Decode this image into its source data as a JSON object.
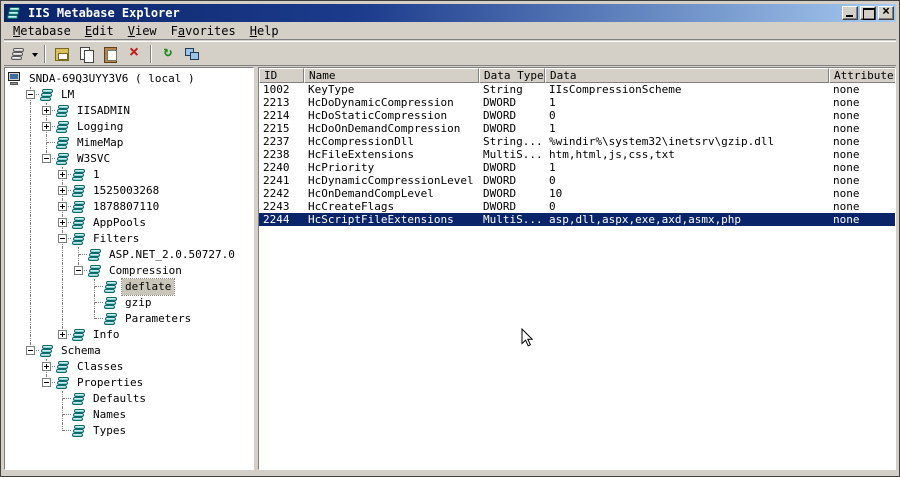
{
  "window": {
    "title": "IIS Metabase Explorer",
    "controls": [
      {
        "name": "minimize"
      },
      {
        "name": "maximize"
      },
      {
        "name": "close"
      }
    ]
  },
  "menu": {
    "items": [
      {
        "label": "Metabase",
        "accel": 0
      },
      {
        "label": "Edit",
        "accel": 0
      },
      {
        "label": "View",
        "accel": 0
      },
      {
        "label": "Favorites",
        "accel": 1
      },
      {
        "label": "Help",
        "accel": 0
      }
    ]
  },
  "toolbar": {
    "buttons": [
      {
        "name": "new-key",
        "icon": "stack-gray",
        "dropdown": true
      },
      {
        "separator": true
      },
      {
        "name": "save",
        "icon": "save"
      },
      {
        "name": "copy",
        "icon": "copy"
      },
      {
        "name": "paste",
        "icon": "paste"
      },
      {
        "name": "delete",
        "icon": "delete"
      },
      {
        "separator": true
      },
      {
        "name": "refresh",
        "icon": "refresh"
      },
      {
        "name": "connect",
        "icon": "network"
      }
    ]
  },
  "tree": {
    "items": [
      {
        "label": "SNDA-69Q3UYY3V6 ( local )",
        "level": 0,
        "expand": "",
        "icon": "computer"
      },
      {
        "label": "LM",
        "level": 1,
        "expand": "-",
        "icon": "stack"
      },
      {
        "label": "IISADMIN",
        "level": 2,
        "expand": "+",
        "icon": "stack"
      },
      {
        "label": "Logging",
        "level": 2,
        "expand": "+",
        "icon": "stack"
      },
      {
        "label": "MimeMap",
        "level": 2,
        "expand": "",
        "icon": "stack"
      },
      {
        "label": "W3SVC",
        "level": 2,
        "expand": "-",
        "icon": "stack"
      },
      {
        "label": "1",
        "level": 3,
        "expand": "+",
        "icon": "stack"
      },
      {
        "label": "1525003268",
        "level": 3,
        "expand": "+",
        "icon": "stack"
      },
      {
        "label": "1878807110",
        "level": 3,
        "expand": "+",
        "icon": "stack"
      },
      {
        "label": "AppPools",
        "level": 3,
        "expand": "+",
        "icon": "stack"
      },
      {
        "label": "Filters",
        "level": 3,
        "expand": "-",
        "icon": "stack"
      },
      {
        "label": "ASP.NET_2.0.50727.0",
        "level": 4,
        "expand": "",
        "icon": "stack"
      },
      {
        "label": "Compression",
        "level": 4,
        "expand": "-",
        "icon": "stack"
      },
      {
        "label": "deflate",
        "level": 5,
        "expand": "",
        "icon": "stack",
        "selected": true
      },
      {
        "label": "gzip",
        "level": 5,
        "expand": "",
        "icon": "stack"
      },
      {
        "label": "Parameters",
        "level": 5,
        "expand": "",
        "icon": "stack"
      },
      {
        "label": "Info",
        "level": 3,
        "expand": "+",
        "icon": "stack"
      },
      {
        "label": "Schema",
        "level": 1,
        "expand": "-",
        "icon": "stack"
      },
      {
        "label": "Classes",
        "level": 2,
        "expand": "+",
        "icon": "stack"
      },
      {
        "label": "Properties",
        "level": 2,
        "expand": "-",
        "icon": "stack"
      },
      {
        "label": "Defaults",
        "level": 3,
        "expand": "",
        "icon": "stack"
      },
      {
        "label": "Names",
        "level": 3,
        "expand": "",
        "icon": "stack"
      },
      {
        "label": "Types",
        "level": 3,
        "expand": "",
        "icon": "stack"
      }
    ]
  },
  "list": {
    "columns": [
      "ID",
      "Name",
      "Data Type",
      "Data",
      "Attributes"
    ],
    "rows": [
      [
        "1002",
        "KeyType",
        "String",
        "IIsCompressionScheme",
        "none"
      ],
      [
        "2213",
        "HcDoDynamicCompression",
        "DWORD",
        "1",
        "none"
      ],
      [
        "2214",
        "HcDoStaticCompression",
        "DWORD",
        "0",
        "none"
      ],
      [
        "2215",
        "HcDoOnDemandCompression",
        "DWORD",
        "1",
        "none"
      ],
      [
        "2237",
        "HcCompressionDll",
        "String...",
        "%windir%\\system32\\inetsrv\\gzip.dll",
        "none"
      ],
      [
        "2238",
        "HcFileExtensions",
        "MultiS...",
        "htm,html,js,css,txt",
        "none"
      ],
      [
        "2240",
        "HcPriority",
        "DWORD",
        "1",
        "none"
      ],
      [
        "2241",
        "HcDynamicCompressionLevel",
        "DWORD",
        "0",
        "none"
      ],
      [
        "2242",
        "HcOnDemandCompLevel",
        "DWORD",
        "10",
        "none"
      ],
      [
        "2243",
        "HcCreateFlags",
        "DWORD",
        "0",
        "none"
      ],
      [
        "2244",
        "HcScriptFileExtensions",
        "MultiS...",
        "asp,dll,aspx,exe,axd,asmx,php",
        "none"
      ]
    ],
    "selected_id": "2244"
  },
  "colors": {
    "selection": "#0a246a",
    "titlebar_left": "#0a246a",
    "titlebar_right": "#a6caf0",
    "chrome": "#d4d0c8",
    "inactive_selection": "#c9c5b9"
  }
}
